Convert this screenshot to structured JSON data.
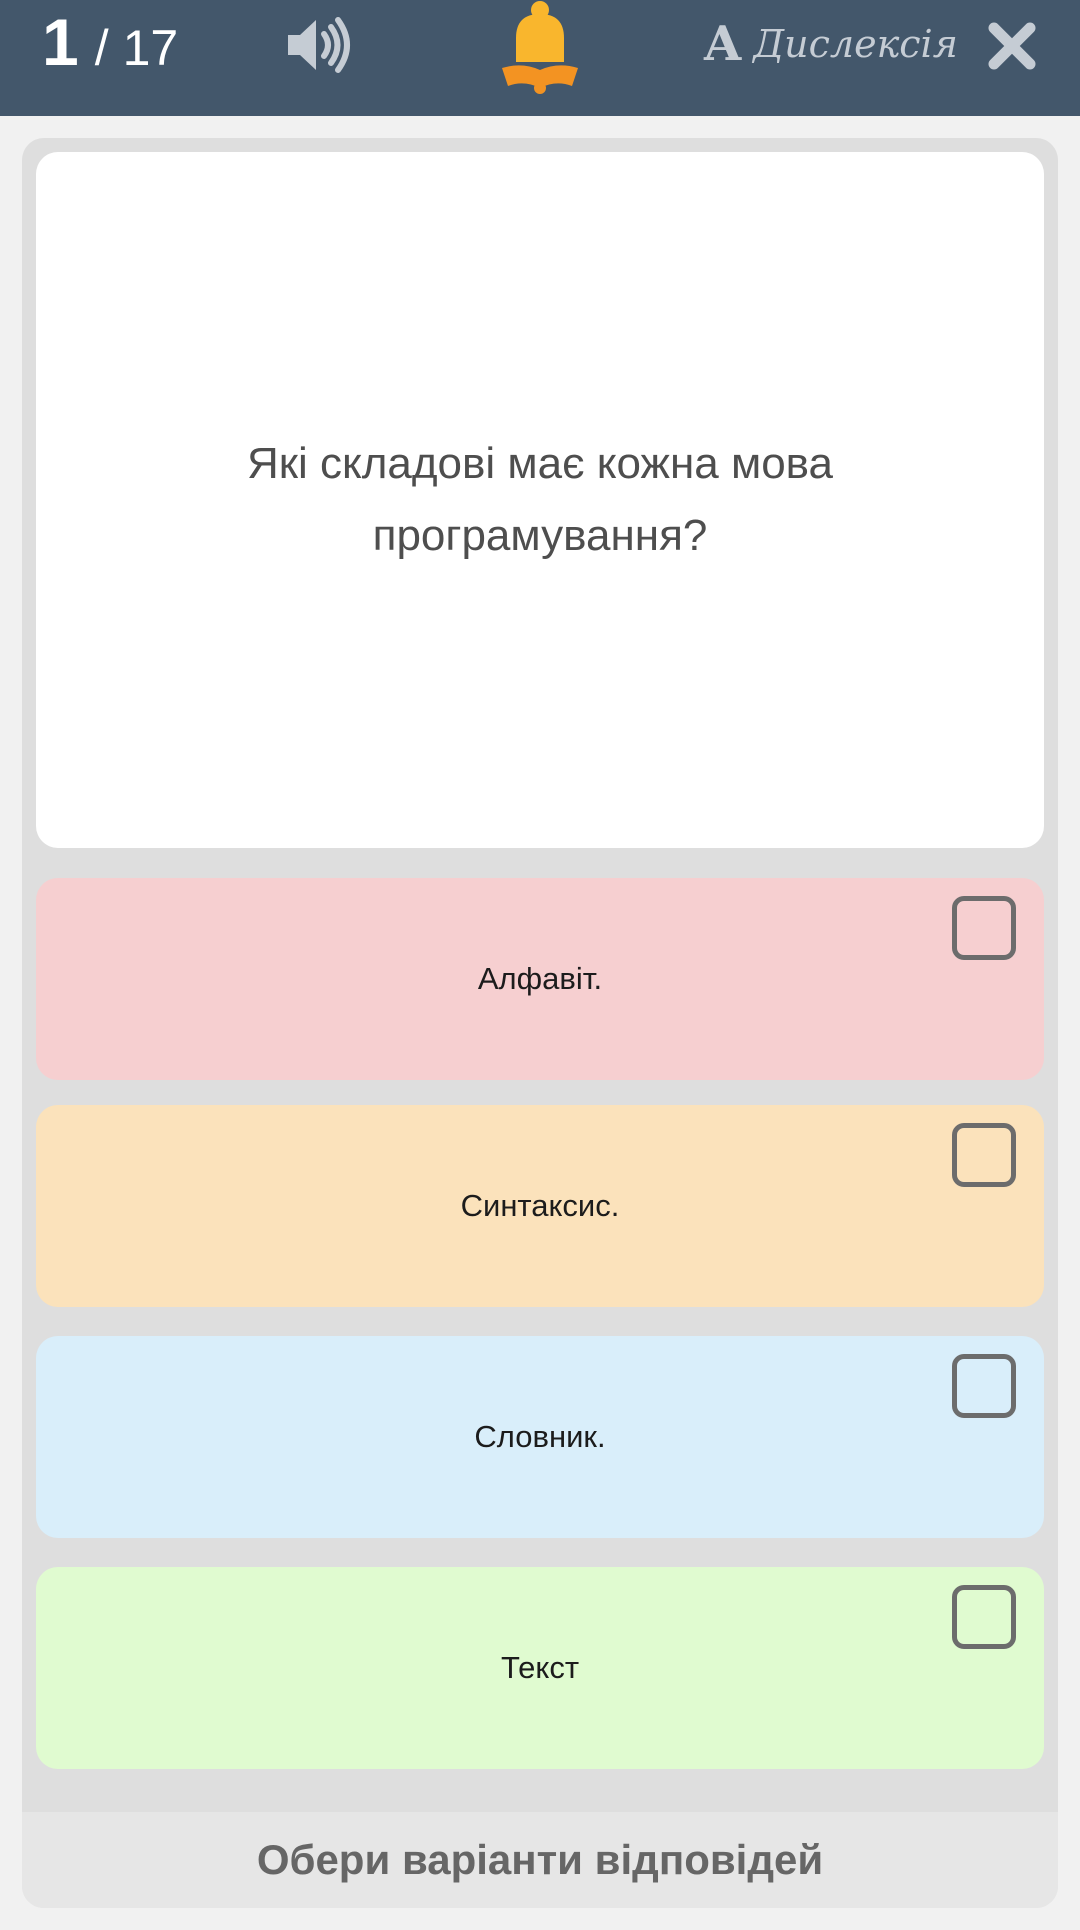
{
  "header": {
    "current": "1",
    "separator": "/",
    "total": "17",
    "sound_icon": "speaker-icon",
    "bell_icon": "bell-book-icon",
    "dyslexia_glyph": "A",
    "dyslexia_label": "Дислексія",
    "close_icon": "close-icon"
  },
  "question": {
    "text": "Які складові має кожна мова програмування?"
  },
  "answers": [
    {
      "label": "Алфавіт.",
      "color": "#f6cfd0",
      "checked": false
    },
    {
      "label": "Синтаксис.",
      "color": "#fbe2bb",
      "checked": false
    },
    {
      "label": "Словник.",
      "color": "#d9eefa",
      "checked": false
    },
    {
      "label": "Текст",
      "color": "#e0fbd0",
      "checked": false
    }
  ],
  "footer": {
    "label": "Обери варіанти відповідей"
  },
  "colors": {
    "topbar": "#43576b",
    "bell": "#f9b62d",
    "bell_book": "#f39322"
  }
}
